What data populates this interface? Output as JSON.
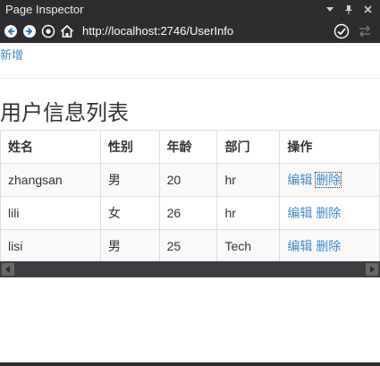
{
  "window": {
    "title": "Page Inspector"
  },
  "toolbar": {
    "url": "http://localhost:2746/UserInfo"
  },
  "page": {
    "new_link": "新增",
    "heading": "用户信息列表",
    "columns": [
      "姓名",
      "性别",
      "年龄",
      "部门",
      "操作"
    ],
    "rows": [
      {
        "name": "zhangsan",
        "gender": "男",
        "age": "20",
        "dept": "hr",
        "edit": "编辑",
        "delete": "删除"
      },
      {
        "name": "lili",
        "gender": "女",
        "age": "26",
        "dept": "hr",
        "edit": "编辑",
        "delete": "删除"
      },
      {
        "name": "lisi",
        "gender": "男",
        "age": "25",
        "dept": "Tech",
        "edit": "编辑",
        "delete": "删除"
      }
    ]
  },
  "colors": {
    "accent": "#428bca",
    "chrome": "#2d2d30"
  }
}
